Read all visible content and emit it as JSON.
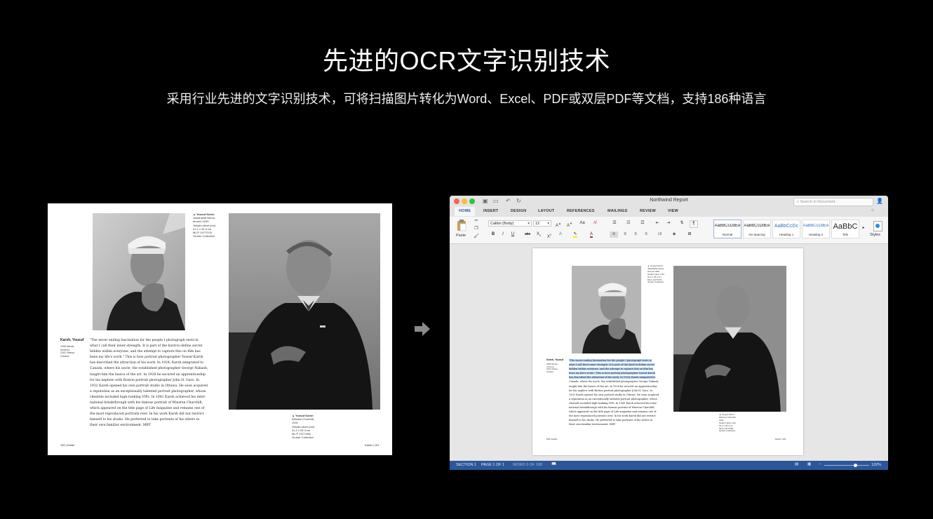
{
  "hero": {
    "title": "先进的OCR文字识别技术",
    "subtitle": "采用行业先进的文字识别技术，可将扫描图片转化为Word、Excel、PDF或双层PDF等文档，支持186种语言"
  },
  "book": {
    "caption_nehru": [
      "▲ Yousuf Karsh",
      "Jawaharlal Nehru,",
      "around 1949",
      "Gelatin silver print",
      "31.2 x 25.3 cm",
      "ML/F 1977/376",
      "Gruber Collection"
    ],
    "caption_churchill": [
      "▲ Yousuf Karsh",
      "Winston Churchill,",
      "1941",
      "Gelatin silver print",
      "31.2 x 25.3 cm",
      "ML/F 1977/369",
      "Gruber Collection"
    ],
    "author_name": "Karsh, Yousuf",
    "author_meta": [
      "1908 Mardin,",
      "Armenia",
      "2002 Ottawa",
      "Canada"
    ],
    "body_lines": [
      "\"The never ending fascination for the people I photograph rests in",
      "what I call their inner strength. It is part of the hard-to-define secret",
      "hidden within everyone, and the attempt to capture this on film has",
      "been my life's work.\" This is how portrait photographer Yousuf Karsh",
      "has described the attraction of his work. In 1924, Karsh emigrated to",
      "Canada, where his uncle, the established photographer George Nakash,",
      "taught him the basics of the art. In 1928 he secured an apprenticeship",
      "for his nephew with Boston portrait photographer John H. Garo. In",
      "1932 Karsh opened his own portrait studio in Ottawa. He soon acquired",
      "a reputation as an exceptionally talented portrait photographer, whose",
      "clientele included high-ranking VIPs. In 1941 Karsh achieved his inter-",
      "national breakthrough with his famous portrait of Winston Churchill,",
      "which appeared on the title page of Life magazine and remains one of",
      "the most reproduced portraits ever. In his work Karsh did not restrict",
      "himself to his studio. He preferred to take portraits of his sitters in",
      "their own familiar environment.   MBT"
    ],
    "folio_left": "100 | Karsh",
    "folio_right": "Karsh | 101"
  },
  "word": {
    "window_title": "Northwind Report",
    "search_placeholder": "Search in Document",
    "tabs": [
      "HOME",
      "INSERT",
      "DESIGN",
      "LAYOUT",
      "REFERENCES",
      "MAILINGS",
      "REVIEW",
      "VIEW"
    ],
    "paste_label": "Paste",
    "font_name": "Calibri (Body)",
    "font_size": "12",
    "styles": [
      {
        "preview": "AaBbCcDdEe",
        "name": "Normal"
      },
      {
        "preview": "AaBbCcDdEe",
        "name": "No Spacing"
      },
      {
        "preview": "AaBbCcDc",
        "name": "Heading 1"
      },
      {
        "preview": "AaBbCcDdEe",
        "name": "Heading 2"
      },
      {
        "preview": "AaBbC",
        "name": "Title"
      }
    ],
    "styles_pane_label": "Styles",
    "status": {
      "section": "SECTION 1",
      "page": "PAGE 1 OF 1",
      "words": "WORD 0 OF 168",
      "zoom": "132%"
    },
    "zoom_level": 0.7,
    "doc": {
      "author_name": "Karsh, Yousuf",
      "folio_left": "100 | Karsh",
      "folio_right": "Karsh | 101"
    }
  }
}
